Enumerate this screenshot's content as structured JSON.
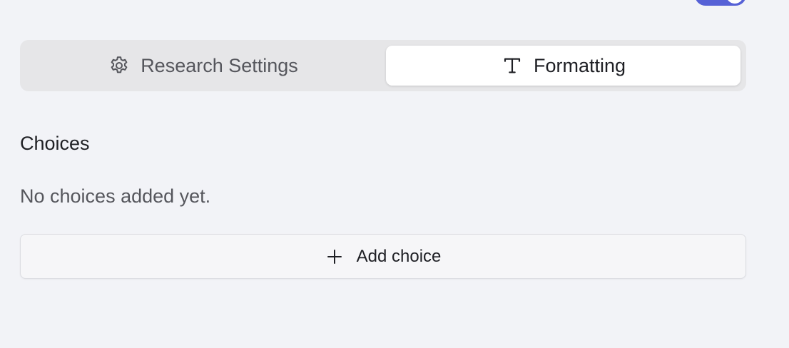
{
  "toggle": {
    "state": "on",
    "color": "#5661d6"
  },
  "tabs": [
    {
      "label": "Research Settings",
      "icon": "gear-icon",
      "active": false
    },
    {
      "label": "Formatting",
      "icon": "text-type-icon",
      "active": true
    }
  ],
  "choices": {
    "title": "Choices",
    "empty_message": "No choices added yet.",
    "add_label": "Add choice",
    "add_icon": "plus-icon"
  }
}
